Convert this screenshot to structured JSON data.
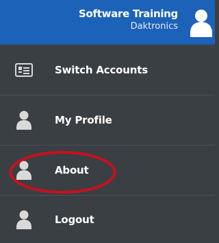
{
  "header": {
    "user_name": "Software Training",
    "organization": "Daktronics",
    "avatar_icon": "user-silhouette-icon"
  },
  "menu": {
    "items": [
      {
        "label": "Switch Accounts",
        "icon": "id-card-icon"
      },
      {
        "label": "My Profile",
        "icon": "user-silhouette-icon"
      },
      {
        "label": "About",
        "icon": "user-silhouette-icon"
      },
      {
        "label": "Logout",
        "icon": "user-silhouette-icon"
      }
    ]
  },
  "annotation": {
    "highlight_color": "#c8101e",
    "highlighted_item": "About"
  },
  "colors": {
    "header_bg": "#1c62b8",
    "menu_bg": "#3a3f44",
    "text": "#ffffff",
    "icon": "#d9d9d9"
  }
}
